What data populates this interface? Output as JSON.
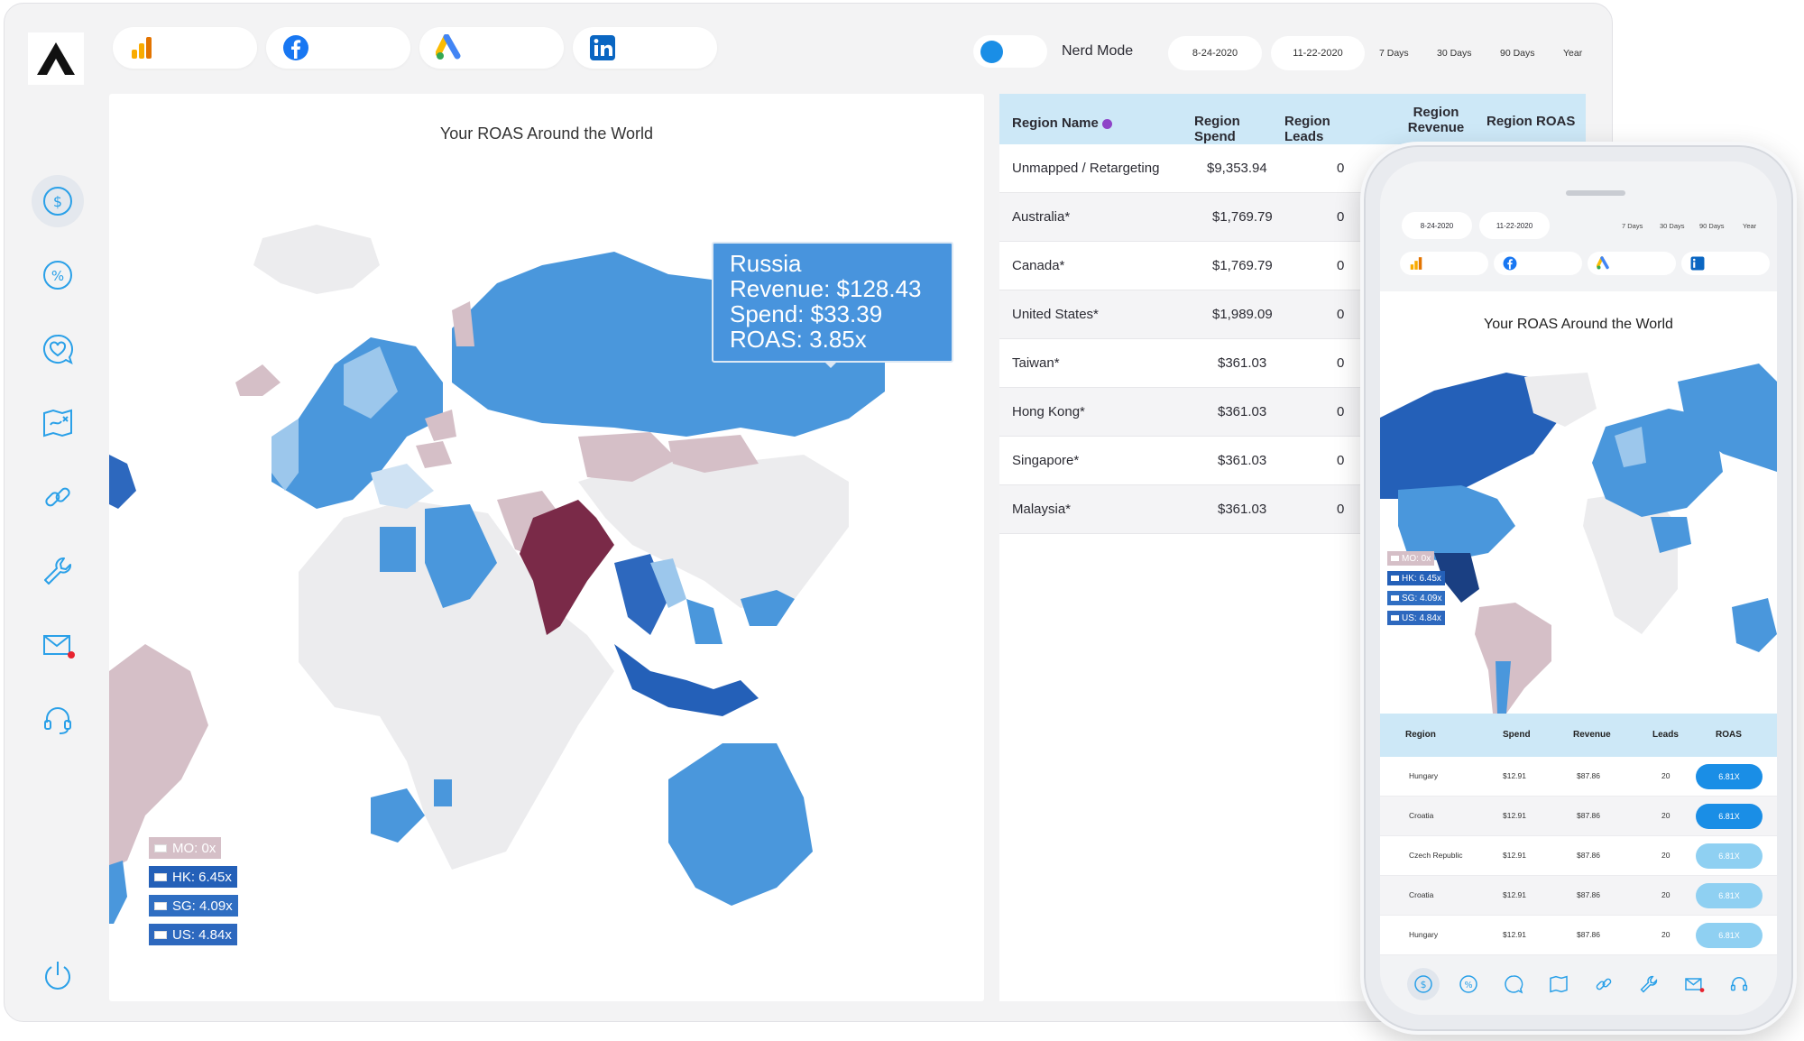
{
  "colors": {
    "accent": "#1a8ee6",
    "tableHeader": "#cde8f7",
    "mapBlue": "#4a97dc",
    "mapDark": "#2460b8",
    "mapLight": "#9cc7ec",
    "mapPink": "#d5bfc7",
    "mapIndia": "#7a2a48",
    "mapGrey": "#ececee"
  },
  "platforms": [
    {
      "icon": "google-analytics-icon"
    },
    {
      "icon": "facebook-icon"
    },
    {
      "icon": "google-ads-icon"
    },
    {
      "icon": "linkedin-icon"
    }
  ],
  "nerd_mode": {
    "label": "Nerd Mode",
    "enabled": true
  },
  "dates": {
    "start": "8-24-2020",
    "end": "11-22-2020",
    "ranges": [
      "7 Days",
      "30 Days",
      "90 Days",
      "Year"
    ]
  },
  "map": {
    "title": "Your ROAS Around the World",
    "tooltip": {
      "name": "Russia",
      "revenue": "Revenue: $128.43",
      "spend": "Spend: $33.39",
      "roas": "ROAS: 3.85x"
    },
    "legend": [
      {
        "label": "MO: 0x",
        "color": "#d5bfc7"
      },
      {
        "label": "HK: 6.45x",
        "color": "#2460b8"
      },
      {
        "label": "SG: 4.09x",
        "color": "#2f6ec2"
      },
      {
        "label": "US: 4.84x",
        "color": "#2d68be"
      }
    ]
  },
  "table": {
    "headers": [
      "Region Name",
      "Region Spend",
      "Region Leads",
      "Region Revenue",
      "Region ROAS"
    ],
    "rows": [
      {
        "name": "Unmapped / Retargeting",
        "spend": "$9,353.94",
        "leads": "0"
      },
      {
        "name": "Australia*",
        "spend": "$1,769.79",
        "leads": "0"
      },
      {
        "name": "Canada*",
        "spend": "$1,769.79",
        "leads": "0"
      },
      {
        "name": "United States*",
        "spend": "$1,989.09",
        "leads": "0"
      },
      {
        "name": "Taiwan*",
        "spend": "$361.03",
        "leads": "0"
      },
      {
        "name": "Hong Kong*",
        "spend": "$361.03",
        "leads": "0"
      },
      {
        "name": "Singapore*",
        "spend": "$361.03",
        "leads": "0"
      },
      {
        "name": "Malaysia*",
        "spend": "$361.03",
        "leads": "0"
      }
    ]
  },
  "phone": {
    "map_title": "Your ROAS Around the World",
    "legend": [
      {
        "label": "MO: 0x",
        "color": "#d5bfc7"
      },
      {
        "label": "HK: 6.45x",
        "color": "#2460b8"
      },
      {
        "label": "SG: 4.09x",
        "color": "#2f6ec2"
      },
      {
        "label": "US: 4.84x",
        "color": "#2d68be"
      }
    ],
    "headers": [
      "Region",
      "Spend",
      "Revenue",
      "Leads",
      "ROAS"
    ],
    "rows": [
      {
        "region": "Hungary",
        "spend": "$12.91",
        "revenue": "$87.86",
        "leads": "20",
        "roas": "6.81X",
        "color": "#1a8ee6"
      },
      {
        "region": "Croatia",
        "spend": "$12.91",
        "revenue": "$87.86",
        "leads": "20",
        "roas": "6.81X",
        "color": "#1a8ee6"
      },
      {
        "region": "Czech Republic",
        "spend": "$12.91",
        "revenue": "$87.86",
        "leads": "20",
        "roas": "6.81X",
        "color": "#8fd0f2"
      },
      {
        "region": "Croatia",
        "spend": "$12.91",
        "revenue": "$87.86",
        "leads": "20",
        "roas": "6.81X",
        "color": "#8fd0f2"
      },
      {
        "region": "Hungary",
        "spend": "$12.91",
        "revenue": "$87.86",
        "leads": "20",
        "roas": "6.81X",
        "color": "#8fd0f2"
      }
    ]
  },
  "sidebar": {
    "items": [
      {
        "icon": "dollar-icon",
        "active": true
      },
      {
        "icon": "percent-icon"
      },
      {
        "icon": "heart-chat-icon"
      },
      {
        "icon": "map-icon"
      },
      {
        "icon": "link-icon"
      },
      {
        "icon": "wrench-icon"
      },
      {
        "icon": "mail-icon",
        "notification": true
      },
      {
        "icon": "headset-icon"
      }
    ],
    "footer_icon": "power-icon"
  }
}
